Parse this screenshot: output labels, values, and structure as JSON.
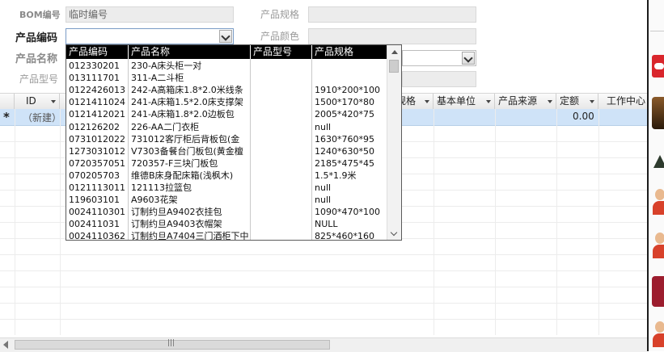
{
  "form": {
    "bom_label": "BOM编号",
    "bom_value": "临时编号",
    "product_code_label": "产品编码",
    "product_code_value": "",
    "product_name_label": "产品名称",
    "product_model_label": "产品型号",
    "product_spec_label": "产品规格",
    "product_color_label": "产品颜色"
  },
  "grid": {
    "columns": [
      "ID",
      "规格",
      "基本单位",
      "产品来源",
      "定额",
      "工作中心"
    ],
    "new_row_marker": "*",
    "new_row_label": "（新建）",
    "new_row_quota": "0.00"
  },
  "dropdown": {
    "headers": [
      "产品编码",
      "产品名称",
      "产品型号",
      "产品规格"
    ],
    "rows": [
      [
        "012330201",
        "230-A床头柜一对",
        "",
        ""
      ],
      [
        "013111701",
        "311-A二斗柜",
        "",
        ""
      ],
      [
        "0122426013",
        "242-A高箱床1.8*2.0米线条",
        "",
        "1910*200*100"
      ],
      [
        "0121411024",
        "241-A床箱1.5*2.0床支撑架",
        "",
        "1500*170*80"
      ],
      [
        "0121412021",
        "241-A床箱1.8*2.0边板包",
        "",
        "2005*420*75"
      ],
      [
        "012126202",
        "226-AA二门衣柜",
        "",
        "null"
      ],
      [
        "0731012022",
        "731012客厅柜后背板包(金",
        "",
        "1630*760*95"
      ],
      [
        "1273031012",
        "V7303备餐台门板包(黄金檀",
        "",
        "1240*630*50"
      ],
      [
        "0720357051",
        "720357-F三块门板包",
        "",
        "2185*475*45"
      ],
      [
        "070205703",
        "维德B床身配床箱(浅枫木)",
        "",
        "1.5*1.9米"
      ],
      [
        "0121113011",
        "121113拉篮包",
        "",
        "null"
      ],
      [
        "119603101",
        "A9603花架",
        "",
        "null"
      ],
      [
        "0024110301",
        "订制约旦A9402衣挂包",
        "",
        "1090*470*100"
      ],
      [
        "002411031",
        "订制约旦A9403衣帽架",
        "",
        "NULL"
      ],
      [
        "0024110362",
        "订制约旦A7404三门酒柜下中",
        "",
        "825*460*160"
      ]
    ]
  },
  "scrollbar": {
    "grip": "|||"
  },
  "icons": {
    "dropdown_arrow": "chevron-down-icon",
    "filter": "filter-dropdown-icon"
  }
}
